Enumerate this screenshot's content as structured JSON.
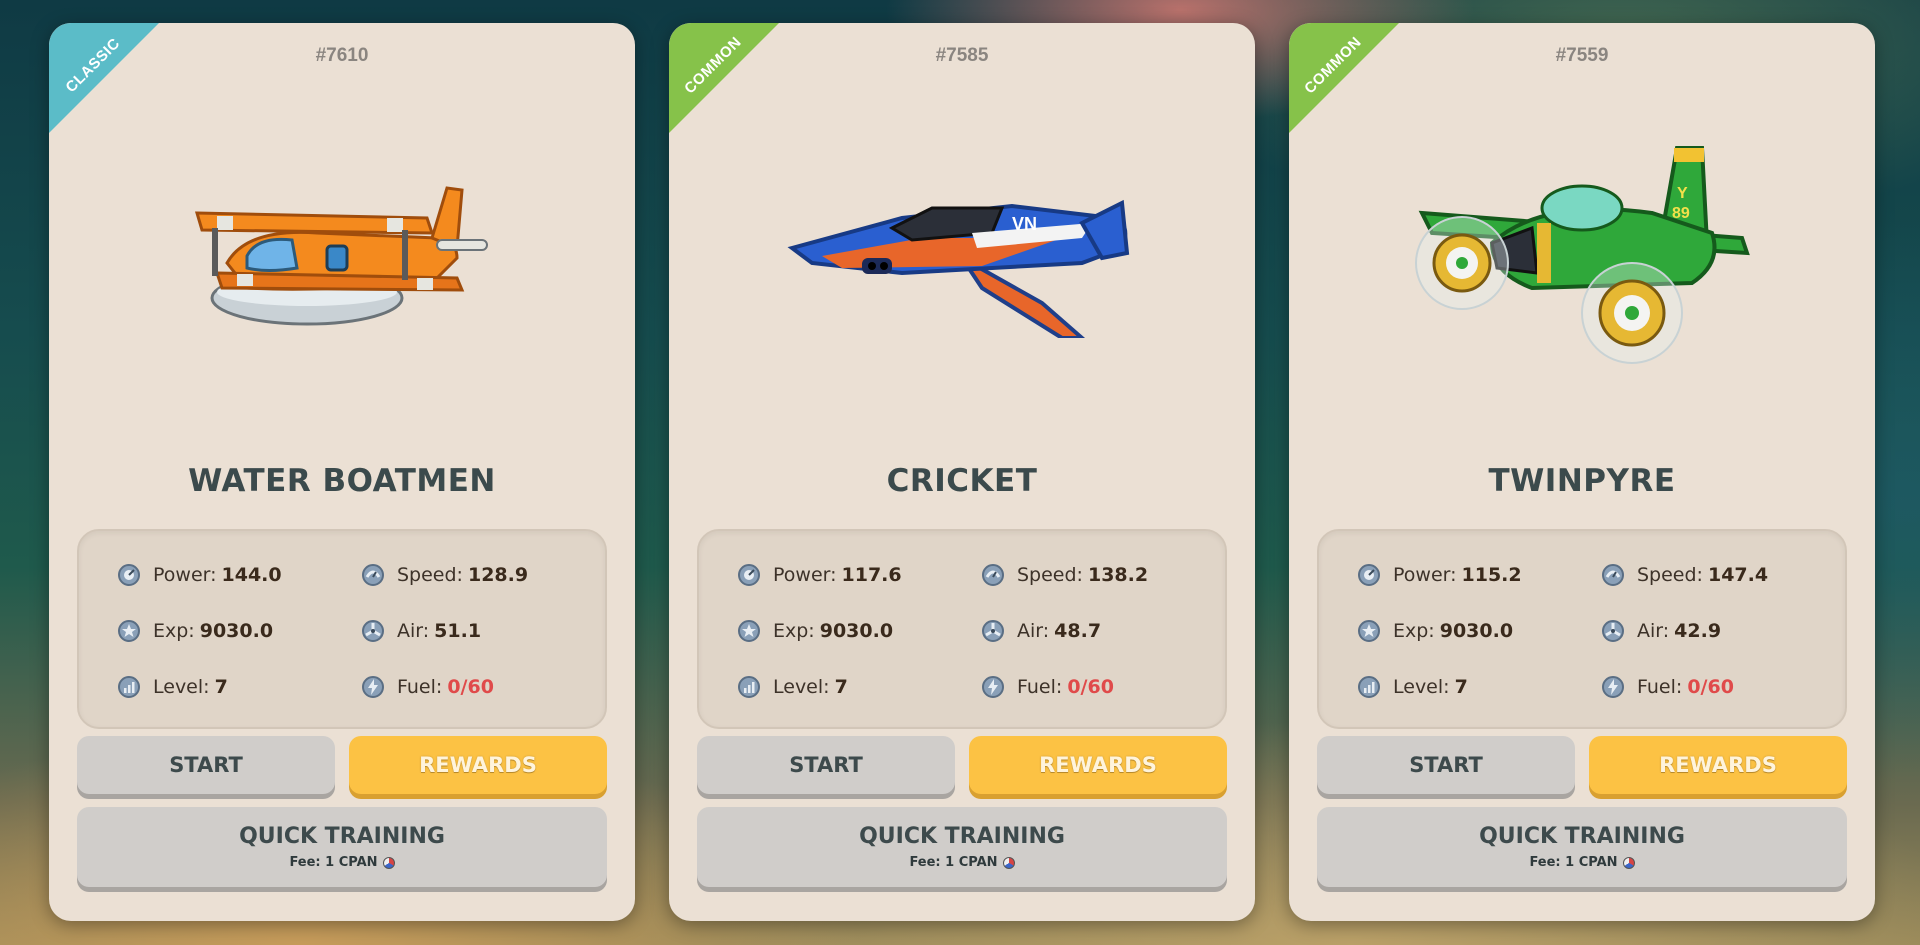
{
  "cards": [
    {
      "rarity": "CLASSIC",
      "rarity_color": "#5bbcc8",
      "id": "#7610",
      "name": "WATER BOATMEN",
      "stats": {
        "power": {
          "label": "Power:",
          "value": "144.0"
        },
        "speed": {
          "label": "Speed:",
          "value": "128.9"
        },
        "exp": {
          "label": "Exp:",
          "value": "9030.0"
        },
        "air": {
          "label": "Air:",
          "value": "51.1"
        },
        "level": {
          "label": "Level:",
          "value": "7"
        },
        "fuel": {
          "label": "Fuel:",
          "value": "0/60"
        }
      },
      "buttons": {
        "start": "START",
        "rewards": "REWARDS",
        "quick_training": "QUICK TRAINING",
        "fee": "Fee: 1 CPAN"
      }
    },
    {
      "rarity": "COMMON",
      "rarity_color": "#86c24a",
      "id": "#7585",
      "name": "CRICKET",
      "stats": {
        "power": {
          "label": "Power:",
          "value": "117.6"
        },
        "speed": {
          "label": "Speed:",
          "value": "138.2"
        },
        "exp": {
          "label": "Exp:",
          "value": "9030.0"
        },
        "air": {
          "label": "Air:",
          "value": "48.7"
        },
        "level": {
          "label": "Level:",
          "value": "7"
        },
        "fuel": {
          "label": "Fuel:",
          "value": "0/60"
        }
      },
      "buttons": {
        "start": "START",
        "rewards": "REWARDS",
        "quick_training": "QUICK TRAINING",
        "fee": "Fee: 1 CPAN"
      }
    },
    {
      "rarity": "COMMON",
      "rarity_color": "#86c24a",
      "id": "#7559",
      "name": "TWINPYRE",
      "stats": {
        "power": {
          "label": "Power:",
          "value": "115.2"
        },
        "speed": {
          "label": "Speed:",
          "value": "147.4"
        },
        "exp": {
          "label": "Exp:",
          "value": "9030.0"
        },
        "air": {
          "label": "Air:",
          "value": "42.9"
        },
        "level": {
          "label": "Level:",
          "value": "7"
        },
        "fuel": {
          "label": "Fuel:",
          "value": "0/60"
        }
      },
      "buttons": {
        "start": "START",
        "rewards": "REWARDS",
        "quick_training": "QUICK TRAINING",
        "fee": "Fee: 1 CPAN"
      }
    }
  ],
  "icons": {
    "power": "power-gauge-icon",
    "speed": "speed-icon",
    "exp": "star-icon",
    "air": "propeller-icon",
    "level": "level-bars-icon",
    "fuel": "lightning-icon",
    "fee": "cpan-coin-icon"
  },
  "plane_names": [
    "orange-biplane-seaplane",
    "blue-orange-jet",
    "green-twin-propeller-plane"
  ],
  "colors": {
    "card_bg": "#ebe0d4",
    "stats_bg": "#e0d5c8",
    "name_text": "#3b4a4c",
    "fuel_red": "#e04a4a",
    "rewards_yellow": "#fcc244",
    "start_gray": "#d0cdca"
  }
}
